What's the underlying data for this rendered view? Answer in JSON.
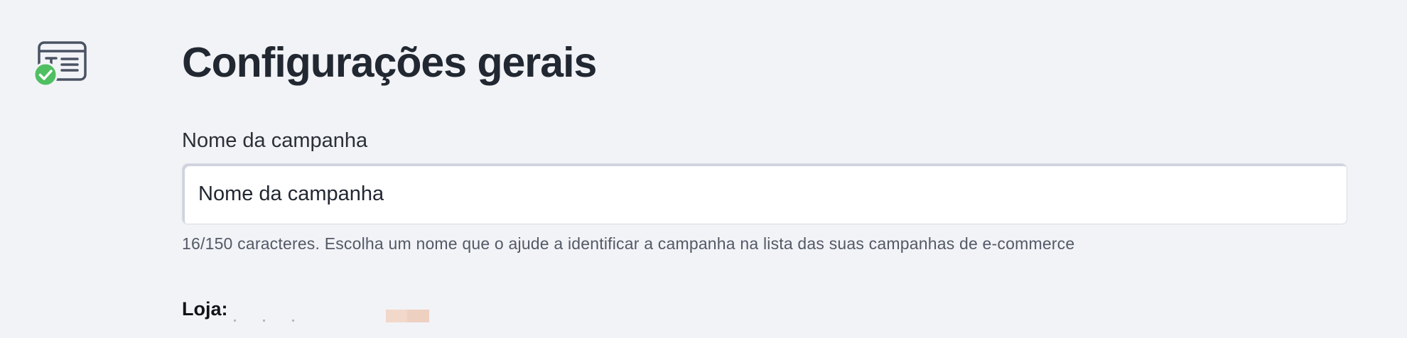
{
  "section": {
    "icon": "text-block-check-icon",
    "title": "Configurações gerais"
  },
  "campaign_name": {
    "label": "Nome da campanha",
    "value": "Nome da campanha",
    "helper": "16/150 caracteres. Escolha um nome que o ajude a identificar a campanha na lista das suas campanhas de e-commerce"
  },
  "store": {
    "label": "Loja:"
  },
  "colors": {
    "background": "#f2f3f7",
    "title": "#222831",
    "icon_stroke": "#4a5363",
    "check_badge": "#4fbf62",
    "helper_text": "#535a66"
  }
}
